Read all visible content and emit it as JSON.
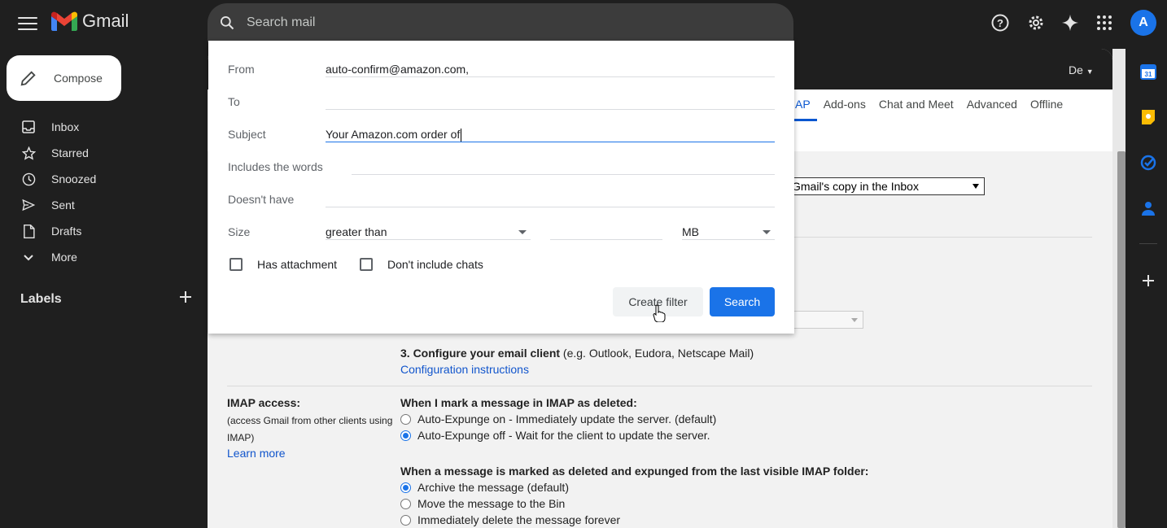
{
  "app": {
    "name": "Gmail"
  },
  "search": {
    "placeholder": "Search mail"
  },
  "sidebar": {
    "compose_label": "Compose",
    "items": [
      {
        "label": "Inbox",
        "icon": "inbox-icon"
      },
      {
        "label": "Starred",
        "icon": "star-icon"
      },
      {
        "label": "Snoozed",
        "icon": "clock-icon"
      },
      {
        "label": "Sent",
        "icon": "send-icon"
      },
      {
        "label": "Drafts",
        "icon": "draft-icon"
      },
      {
        "label": "More",
        "icon": "chevron-down-icon"
      }
    ],
    "labels_heading": "Labels"
  },
  "settings": {
    "lang_label": "De",
    "tabs": [
      {
        "label": "AP",
        "active": true
      },
      {
        "label": "Add-ons"
      },
      {
        "label": "Chat and Meet"
      },
      {
        "label": "Advanced"
      },
      {
        "label": "Offline"
      }
    ],
    "forward_select": "Gmail's copy in the Inbox",
    "configure_heading": "3. Configure your email client",
    "configure_hint": " (e.g. Outlook, Eudora, Netscape Mail)",
    "config_link": "Configuration instructions",
    "imap_label": "IMAP access:",
    "imap_sub": "(access Gmail from other clients using IMAP)",
    "learn_more": "Learn more",
    "deleted_heading": "When I mark a message in IMAP as deleted:",
    "deleted_options": [
      {
        "label": "Auto-Expunge on - Immediately update the server. (default)",
        "selected": false
      },
      {
        "label": "Auto-Expunge off - Wait for the client to update the server.",
        "selected": true
      }
    ],
    "expunged_heading": "When a message is marked as deleted and expunged from the last visible IMAP folder:",
    "expunged_options": [
      {
        "label": "Archive the message (default)",
        "selected": true
      },
      {
        "label": "Move the message to the Bin",
        "selected": false
      },
      {
        "label": "Immediately delete the message forever",
        "selected": false
      }
    ]
  },
  "filter_popup": {
    "from_label": "From",
    "from_value": "auto-confirm@amazon.com,",
    "to_label": "To",
    "to_value": "",
    "subject_label": "Subject",
    "subject_value": "Your Amazon.com order of",
    "includes_label": "Includes the words",
    "includes_value": "",
    "doesnt_have_label": "Doesn't have",
    "doesnt_have_value": "",
    "size_label": "Size",
    "size_operator": "greater than",
    "size_value": "",
    "size_unit": "MB",
    "has_attachment_label": "Has attachment",
    "no_chats_label": "Don't include chats",
    "create_filter_label": "Create filter",
    "search_label": "Search"
  },
  "colors": {
    "accent": "#1a73e8",
    "background": "#1f1f1f",
    "link": "#1155cc"
  }
}
